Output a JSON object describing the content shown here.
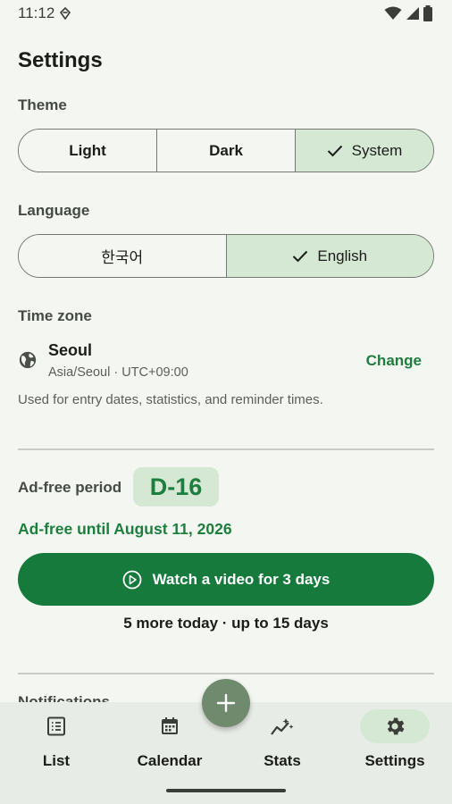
{
  "status_bar": {
    "time": "11:12"
  },
  "page": {
    "title": "Settings"
  },
  "theme": {
    "label": "Theme",
    "options": [
      {
        "label": "Light",
        "selected": false
      },
      {
        "label": "Dark",
        "selected": false
      },
      {
        "label": "System",
        "selected": true
      }
    ]
  },
  "language": {
    "label": "Language",
    "options": [
      {
        "label": "한국어",
        "selected": false
      },
      {
        "label": "English",
        "selected": true
      }
    ]
  },
  "timezone": {
    "label": "Time zone",
    "city": "Seoul",
    "detail": "Asia/Seoul · UTC+09:00",
    "change_label": "Change",
    "help": "Used for entry dates, statistics, and reminder times."
  },
  "ad_free": {
    "label": "Ad-free period",
    "dday": "D-16",
    "until": "Ad-free until August 11, 2026",
    "watch_label": "Watch a video for 3 days",
    "limit_text": "5 more today · up to 15 days"
  },
  "notifications": {
    "label": "Notifications"
  },
  "bottom_nav": {
    "items": [
      {
        "label": "List",
        "icon": "list-icon",
        "active": false
      },
      {
        "label": "Calendar",
        "icon": "calendar-icon",
        "active": false
      },
      {
        "label": "Stats",
        "icon": "stats-icon",
        "active": false
      },
      {
        "label": "Settings",
        "icon": "gear-icon",
        "active": true
      }
    ]
  },
  "fab": {
    "icon": "plus-icon"
  },
  "colors": {
    "accent": "#1e7e3e",
    "accent_button": "#157a3c",
    "selected_bg": "#d5e8d3",
    "background": "#f4f6f2",
    "nav_background": "#e8ece6",
    "fab": "#6f8a6d"
  }
}
